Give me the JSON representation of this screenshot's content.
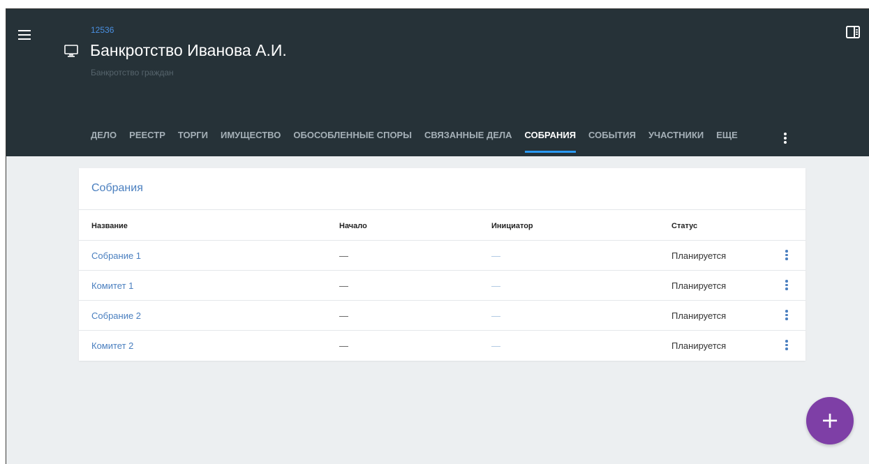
{
  "header": {
    "case_number": "12536",
    "title": "Банкротство Иванова А.И.",
    "subtitle": "Банкротство граждан"
  },
  "tabs": [
    {
      "label": "ДЕЛО"
    },
    {
      "label": "РЕЕСТР"
    },
    {
      "label": "ТОРГИ"
    },
    {
      "label": "ИМУЩЕСТВО"
    },
    {
      "label": "ОБОСОБЛЕННЫЕ СПОРЫ"
    },
    {
      "label": "СВЯЗАННЫЕ ДЕЛА"
    },
    {
      "label": "СОБРАНИЯ",
      "active": true
    },
    {
      "label": "СОБЫТИЯ"
    },
    {
      "label": "УЧАСТНИКИ"
    },
    {
      "label": "ЕЩЕ"
    }
  ],
  "meetings": {
    "title": "Собрания",
    "columns": {
      "name": "Название",
      "start": "Начало",
      "initiator": "Инициатор",
      "status": "Статус"
    },
    "rows": [
      {
        "name": "Собрание 1",
        "start": "—",
        "initiator": "—",
        "status": "Планируется"
      },
      {
        "name": "Комитет 1",
        "start": "—",
        "initiator": "—",
        "status": "Планируется"
      },
      {
        "name": "Собрание 2",
        "start": "—",
        "initiator": "—",
        "status": "Планируется"
      },
      {
        "name": "Комитет 2",
        "start": "—",
        "initiator": "—",
        "status": "Планируется"
      }
    ]
  },
  "fab": {
    "label": "+"
  },
  "icons": {
    "menu": "menu-icon",
    "case": "monitor-icon",
    "panel": "side-panel-icon",
    "more": "more-vert-icon"
  },
  "colors": {
    "header_bg": "#263238",
    "accent": "#2b9af3",
    "link": "#4a7fbf",
    "fab": "#7e3fa6",
    "page_bg": "#eceff1"
  }
}
